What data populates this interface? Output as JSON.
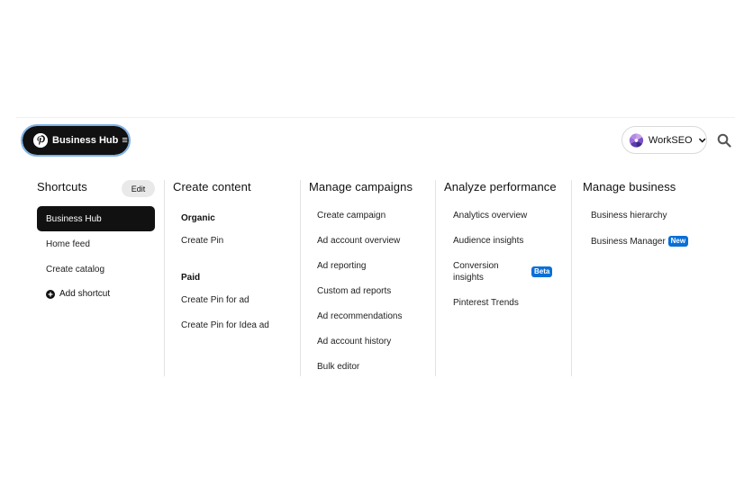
{
  "header": {
    "business_hub_label": "Business Hub",
    "account_name": "WorkSEO"
  },
  "shortcuts": {
    "title": "Shortcuts",
    "edit_label": "Edit",
    "items": [
      "Business Hub",
      "Home feed",
      "Create catalog"
    ],
    "add_label": "Add shortcut"
  },
  "create_content": {
    "title": "Create content",
    "organic_label": "Organic",
    "organic_items": [
      "Create Pin"
    ],
    "paid_label": "Paid",
    "paid_items": [
      "Create Pin for ad",
      "Create Pin for Idea ad"
    ]
  },
  "manage_campaigns": {
    "title": "Manage campaigns",
    "items": [
      "Create campaign",
      "Ad account overview",
      "Ad reporting",
      "Custom ad reports",
      "Ad recommendations",
      "Ad account history",
      "Bulk editor"
    ]
  },
  "analyze_performance": {
    "title": "Analyze performance",
    "items": [
      "Analytics overview",
      "Audience insights",
      "Conversion",
      "insights",
      "Pinterest Trends"
    ],
    "beta_badge": "Beta"
  },
  "manage_business": {
    "title": "Manage business",
    "items": [
      "Business hierarchy",
      "Business Manager"
    ],
    "new_badge": "New"
  },
  "colors": {
    "primary": "#111111",
    "badge_blue": "#0a6fd6",
    "focus_ring": "#7fb3e6"
  }
}
